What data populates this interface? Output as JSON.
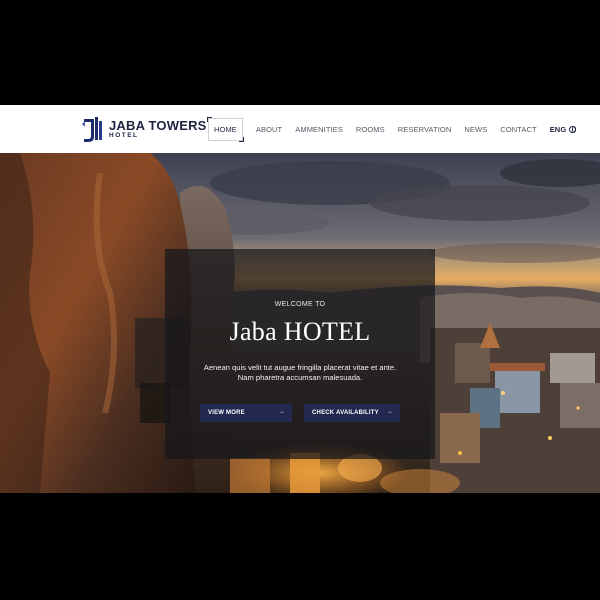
{
  "brand": {
    "name": "JABA TOWERS",
    "subtitle": "HOTEL",
    "accent": "#1f2a6b"
  },
  "nav": {
    "items": [
      "HOME",
      "ABOUT",
      "AMMENITIES",
      "ROOMS",
      "RESERVATION",
      "NEWS",
      "CONTACT"
    ],
    "active": "HOME",
    "language": "ENG",
    "language_icon": "globe-icon"
  },
  "hero": {
    "welcome": "WELCOME TO",
    "title": "Jaba HOTEL",
    "tagline_line1": "Aenean quis velit tut augue fringilla placerat vitae et ante.",
    "tagline_line2": "Nam pharetra accumsan malesuada.",
    "button_more": "VIEW MORE",
    "button_check": "CHECK AVAILABILITY",
    "button_arrow": "→",
    "button_color": "#232850"
  }
}
